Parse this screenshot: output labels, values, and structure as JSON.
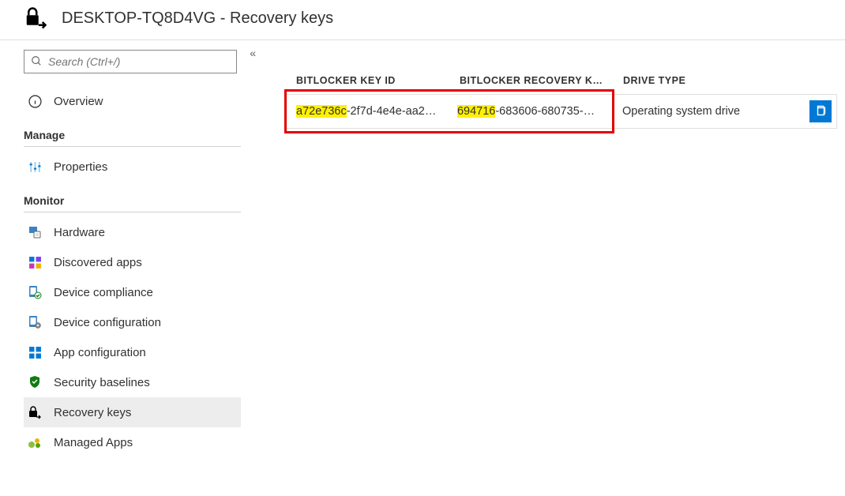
{
  "header": {
    "title": "DESKTOP-TQ8D4VG - Recovery keys"
  },
  "sidebar": {
    "search_placeholder": "Search (Ctrl+/)",
    "overview_label": "Overview",
    "section_manage": "Manage",
    "section_monitor": "Monitor",
    "manage_items": [
      {
        "label": "Properties"
      }
    ],
    "monitor_items": [
      {
        "label": "Hardware"
      },
      {
        "label": "Discovered apps"
      },
      {
        "label": "Device compliance"
      },
      {
        "label": "Device configuration"
      },
      {
        "label": "App configuration"
      },
      {
        "label": "Security baselines"
      },
      {
        "label": "Recovery keys"
      },
      {
        "label": "Managed Apps"
      }
    ]
  },
  "table": {
    "headers": {
      "key_id": "BITLOCKER KEY ID",
      "recovery_key": "BITLOCKER RECOVERY K…",
      "drive_type": "DRIVE TYPE"
    },
    "row": {
      "key_id_highlight": "a72e736c",
      "key_id_rest": "-2f7d-4e4e-aa2…",
      "recovery_highlight": "694716",
      "recovery_rest": "-683606-680735-…",
      "drive_type": "Operating system drive"
    }
  }
}
